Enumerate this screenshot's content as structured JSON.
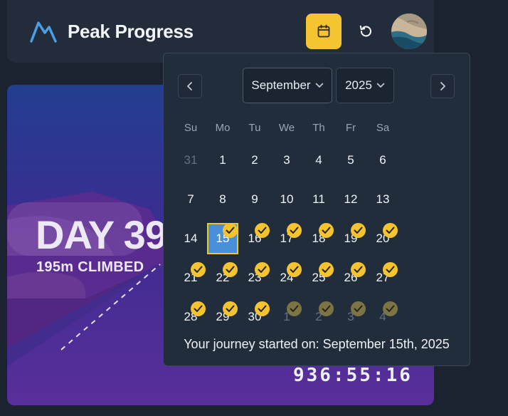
{
  "header": {
    "title": "Peak Progress",
    "logo_icon": "mountain-icon",
    "calendar_button_icon": "calendar-icon",
    "refresh_button_icon": "refresh-icon",
    "avatar_icon": "coastline-photo-avatar"
  },
  "hero": {
    "day_text": "DAY 39",
    "climbed_text": "195m CLIMBED",
    "timer_text": "936:55:16"
  },
  "calendar": {
    "month": "September",
    "year": "2025",
    "prev_icon": "chevron-left-icon",
    "next_icon": "chevron-right-icon",
    "weekdays": [
      "Su",
      "Mo",
      "Tu",
      "We",
      "Th",
      "Fr",
      "Sa"
    ],
    "weeks": [
      [
        {
          "d": "31",
          "muted": true,
          "check": ""
        },
        {
          "d": "1",
          "check": ""
        },
        {
          "d": "2",
          "check": ""
        },
        {
          "d": "3",
          "check": ""
        },
        {
          "d": "4",
          "check": ""
        },
        {
          "d": "5",
          "check": ""
        },
        {
          "d": "6",
          "check": ""
        }
      ],
      [
        {
          "d": "7",
          "check": ""
        },
        {
          "d": "8",
          "check": ""
        },
        {
          "d": "9",
          "check": ""
        },
        {
          "d": "10",
          "check": ""
        },
        {
          "d": "11",
          "check": ""
        },
        {
          "d": "12",
          "check": ""
        },
        {
          "d": "13",
          "check": ""
        }
      ],
      [
        {
          "d": "14",
          "check": ""
        },
        {
          "d": "15",
          "selected": true,
          "check": "on"
        },
        {
          "d": "16",
          "check": "on"
        },
        {
          "d": "17",
          "check": "on"
        },
        {
          "d": "18",
          "check": "on"
        },
        {
          "d": "19",
          "check": "on"
        },
        {
          "d": "20",
          "check": "on"
        }
      ],
      [
        {
          "d": "21",
          "check": "on"
        },
        {
          "d": "22",
          "check": "on"
        },
        {
          "d": "23",
          "check": "on"
        },
        {
          "d": "24",
          "check": "on"
        },
        {
          "d": "25",
          "check": "on"
        },
        {
          "d": "26",
          "check": "on"
        },
        {
          "d": "27",
          "check": "on"
        }
      ],
      [
        {
          "d": "28",
          "check": "on"
        },
        {
          "d": "29",
          "check": "on"
        },
        {
          "d": "30",
          "check": "on"
        },
        {
          "d": "1",
          "muted": true,
          "check": "dim"
        },
        {
          "d": "2",
          "muted": true,
          "check": "dim"
        },
        {
          "d": "3",
          "muted": true,
          "check": "dim"
        },
        {
          "d": "4",
          "muted": true,
          "check": "dim"
        }
      ]
    ],
    "footer": "Your journey started on: September 15th, 2025"
  },
  "colors": {
    "accent": "#f5c531",
    "selected_day": "#4a90d9",
    "background": "#1b2330",
    "panel": "#222d3c"
  }
}
